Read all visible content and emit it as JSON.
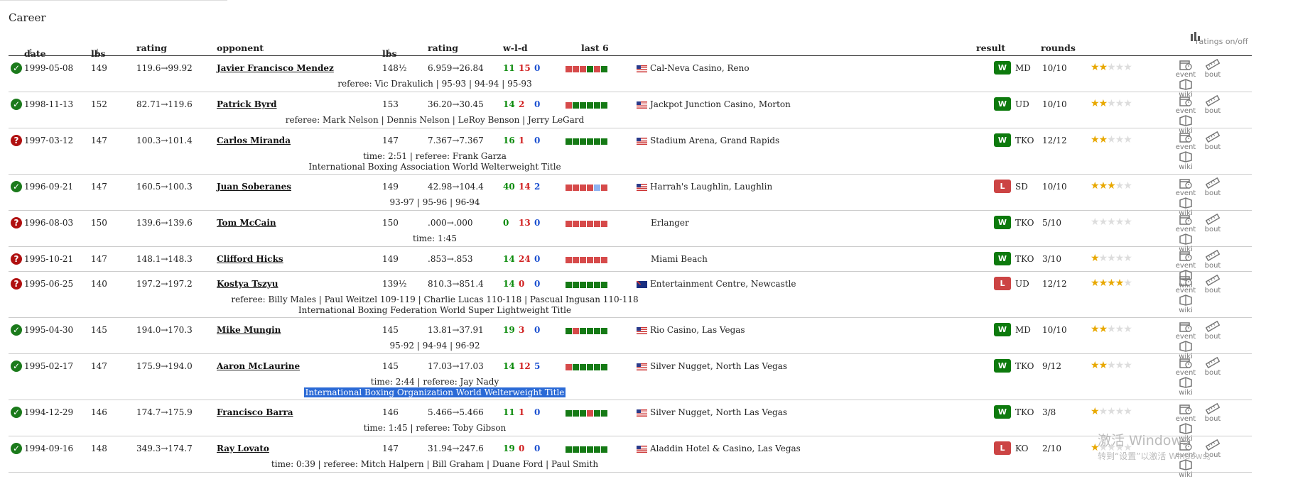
{
  "section_title": "Career",
  "headers": {
    "date": "date",
    "lbs": "lbs",
    "rating": "rating",
    "opponent": "opponent",
    "opp_lbs": "lbs",
    "opp_rating": "rating",
    "wld": "w-l-d",
    "last6": "last 6",
    "result": "result",
    "rounds": "rounds",
    "ratings_toggle": "ratings on/off"
  },
  "icon_labels": {
    "event": "event",
    "bout": "bout",
    "wiki": "wiki"
  },
  "colors": {
    "win_green": "#0d7a0d",
    "loss_red": "#cc4444",
    "draw_blue": "#1a4fd0",
    "star": "#e8a800"
  },
  "rows": [
    {
      "status": "win",
      "date": "1999-05-08",
      "lbs": "149",
      "rating": "119.6→99.92",
      "opponent": "Javier Francisco Mendez",
      "opp_lbs": "148½",
      "opp_rating": "6.959→26.84",
      "w": "11",
      "l": "15",
      "d": "0",
      "last6": [
        "L",
        "L",
        "L",
        "W",
        "L",
        "W"
      ],
      "flag": "us",
      "venue": "Cal-Neva Casino, Reno",
      "result": "W",
      "method": "MD",
      "rounds": "10/10",
      "stars": 2,
      "lines": [
        "referee: Vic Drakulich | 95-93 | 94-94 | 95-93"
      ]
    },
    {
      "status": "win",
      "date": "1998-11-13",
      "lbs": "152",
      "rating": "82.71→119.6",
      "opponent": "Patrick Byrd",
      "opp_lbs": "153",
      "opp_rating": "36.20→30.45",
      "w": "14",
      "l": "2",
      "d": "0",
      "last6": [
        "L",
        "W",
        "W",
        "W",
        "W",
        "W"
      ],
      "flag": "us",
      "venue": "Jackpot Junction Casino, Morton",
      "result": "W",
      "method": "UD",
      "rounds": "10/10",
      "stars": 2,
      "lines": [
        "referee: Mark Nelson | Dennis Nelson | LeRoy Benson | Jerry LeGard"
      ]
    },
    {
      "status": "unk",
      "date": "1997-03-12",
      "lbs": "147",
      "rating": "100.3→101.4",
      "opponent": "Carlos Miranda",
      "opp_lbs": "147",
      "opp_rating": "7.367→7.367",
      "w": "16",
      "l": "1",
      "d": "0",
      "last6": [
        "W",
        "W",
        "W",
        "W",
        "W",
        "W"
      ],
      "flag": "us",
      "venue": "Stadium Arena, Grand Rapids",
      "result": "W",
      "method": "TKO",
      "rounds": "12/12",
      "stars": 2,
      "lines": [
        "time: 2:51 | referee: Frank Garza",
        "International Boxing Association World Welterweight Title"
      ]
    },
    {
      "status": "win",
      "date": "1996-09-21",
      "lbs": "147",
      "rating": "160.5→100.3",
      "opponent": "Juan Soberanes",
      "opp_lbs": "149",
      "opp_rating": "42.98→104.4",
      "w": "40",
      "l": "14",
      "d": "2",
      "last6": [
        "L",
        "L",
        "L",
        "L",
        "D",
        "L"
      ],
      "flag": "us",
      "venue": "Harrah's Laughlin, Laughlin",
      "result": "L",
      "method": "SD",
      "rounds": "10/10",
      "stars": 3,
      "lines": [
        "93-97 | 95-96 | 96-94"
      ]
    },
    {
      "status": "unk",
      "date": "1996-08-03",
      "lbs": "150",
      "rating": "139.6→139.6",
      "opponent": "Tom McCain",
      "opp_lbs": "150",
      "opp_rating": ".000→.000",
      "w": "0",
      "l": "13",
      "d": "0",
      "last6": [
        "L",
        "L",
        "L",
        "L",
        "L",
        "L"
      ],
      "flag": "",
      "venue": "Erlanger",
      "result": "W",
      "method": "TKO",
      "rounds": "5/10",
      "stars": 0,
      "lines": [
        "time: 1:45"
      ]
    },
    {
      "status": "unk",
      "date": "1995-10-21",
      "lbs": "147",
      "rating": "148.1→148.3",
      "opponent": "Clifford Hicks",
      "opp_lbs": "149",
      "opp_rating": ".853→.853",
      "w": "14",
      "l": "24",
      "d": "0",
      "last6": [
        "L",
        "L",
        "L",
        "L",
        "L",
        "L"
      ],
      "flag": "",
      "venue": "Miami Beach",
      "result": "W",
      "method": "TKO",
      "rounds": "3/10",
      "stars": 1,
      "lines": []
    },
    {
      "status": "unk",
      "date": "1995-06-25",
      "lbs": "140",
      "rating": "197.2→197.2",
      "opponent": "Kostya Tszyu",
      "opp_lbs": "139½",
      "opp_rating": "810.3→851.4",
      "w": "14",
      "l": "0",
      "d": "0",
      "last6": [
        "W",
        "W",
        "W",
        "W",
        "W",
        "W"
      ],
      "flag": "au",
      "venue": "Entertainment Centre, Newcastle",
      "result": "L",
      "method": "UD",
      "rounds": "12/12",
      "stars": 4,
      "lines": [
        "referee: Billy Males | Paul Weitzel 109-119 | Charlie Lucas 110-118 | Pascual Ingusan 110-118",
        "International Boxing Federation World Super Lightweight Title"
      ]
    },
    {
      "status": "win",
      "date": "1995-04-30",
      "lbs": "145",
      "rating": "194.0→170.3",
      "opponent": "Mike Mungin",
      "opp_lbs": "145",
      "opp_rating": "13.81→37.91",
      "w": "19",
      "l": "3",
      "d": "0",
      "last6": [
        "W",
        "L",
        "W",
        "W",
        "W",
        "W"
      ],
      "flag": "us",
      "venue": "Rio Casino, Las Vegas",
      "result": "W",
      "method": "MD",
      "rounds": "10/10",
      "stars": 2,
      "lines": [
        "95-92 | 94-94 | 96-92"
      ]
    },
    {
      "status": "win",
      "date": "1995-02-17",
      "lbs": "147",
      "rating": "175.9→194.0",
      "opponent": "Aaron McLaurine",
      "opp_lbs": "145",
      "opp_rating": "17.03→17.03",
      "w": "14",
      "l": "12",
      "d": "5",
      "last6": [
        "L",
        "W",
        "W",
        "W",
        "W",
        "W"
      ],
      "flag": "us",
      "venue": "Silver Nugget, North Las Vegas",
      "result": "W",
      "method": "TKO",
      "rounds": "9/12",
      "stars": 2,
      "lines": [
        "time: 2:44 | referee: Jay Nady",
        "International Boxing Organization World Welterweight Title"
      ],
      "highlight_line": 1
    },
    {
      "status": "win",
      "date": "1994-12-29",
      "lbs": "146",
      "rating": "174.7→175.9",
      "opponent": "Francisco Barra",
      "opp_lbs": "146",
      "opp_rating": "5.466→5.466",
      "w": "11",
      "l": "1",
      "d": "0",
      "last6": [
        "W",
        "W",
        "W",
        "L",
        "W",
        "W"
      ],
      "flag": "us",
      "venue": "Silver Nugget, North Las Vegas",
      "result": "W",
      "method": "TKO",
      "rounds": "3/8",
      "stars": 1,
      "lines": [
        "time: 1:45 | referee: Toby Gibson"
      ]
    },
    {
      "status": "win",
      "date": "1994-09-16",
      "lbs": "148",
      "rating": "349.3→174.7",
      "opponent": "Ray Lovato",
      "opp_lbs": "147",
      "opp_rating": "31.94→247.6",
      "w": "19",
      "l": "0",
      "d": "0",
      "last6": [
        "W",
        "W",
        "W",
        "W",
        "W",
        "W"
      ],
      "flag": "us",
      "venue": "Aladdin Hotel & Casino, Las Vegas",
      "result": "L",
      "method": "KO",
      "rounds": "2/10",
      "stars": 1,
      "lines": [
        "time: 0:39 | referee: Mitch Halpern | Bill Graham | Duane Ford | Paul Smith"
      ]
    }
  ],
  "watermark": {
    "line1": "激活 Windows",
    "line2": "转到“设置”以激活 Windows。"
  }
}
